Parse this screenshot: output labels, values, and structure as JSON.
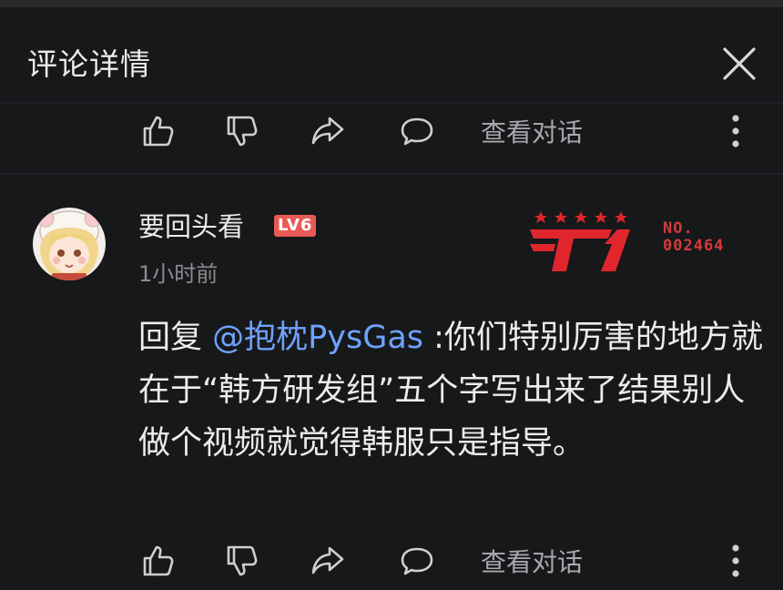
{
  "header": {
    "title": "评论详情",
    "close_icon": "close-icon"
  },
  "top_actions": {
    "view_dialog": "查看对话"
  },
  "comment": {
    "username": "要回头看",
    "level": "LV6",
    "time": "1小时前",
    "badge": {
      "brand": "T1",
      "number_label": "NO.",
      "number": "002464"
    },
    "reply_prefix": "回复 ",
    "mention": "@抱枕PysGas",
    "text": " :你们特别厉害的地方就在于“韩方研发组”五个字写出来了结果别人做个视频就觉得韩服只是指导。"
  },
  "bottom_actions": {
    "view_dialog": "查看对话"
  },
  "colors": {
    "background": "#17181a",
    "mention": "#6ea2ff",
    "level_badge": "#e85a55",
    "brand_red": "#e0262c"
  }
}
